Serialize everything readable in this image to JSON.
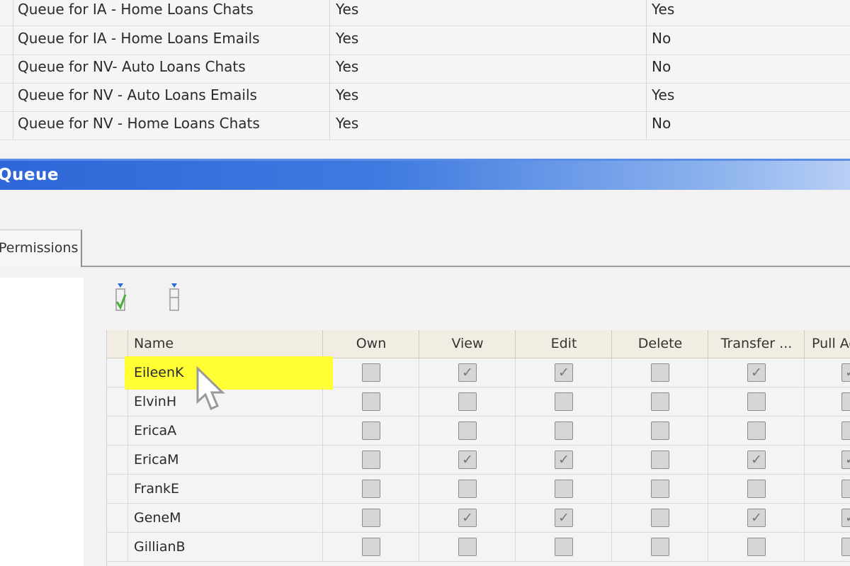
{
  "queue_rows": [
    {
      "name": "Queue for IA - Home Loans Chats",
      "col2": "Yes",
      "col3": "Yes"
    },
    {
      "name": "Queue for IA - Home Loans Emails",
      "col2": "Yes",
      "col3": "No"
    },
    {
      "name": "Queue for NV- Auto Loans Chats",
      "col2": "Yes",
      "col3": "No"
    },
    {
      "name": "Queue for NV - Auto Loans Emails",
      "col2": "Yes",
      "col3": "Yes"
    },
    {
      "name": "Queue for NV - Home Loans Chats",
      "col2": "Yes",
      "col3": "No"
    }
  ],
  "section_title": "Queue",
  "tab_label": "Permissions",
  "toolbar": {
    "icons": [
      "check-all-icon",
      "uncheck-all-icon"
    ]
  },
  "grid": {
    "columns": [
      "Name",
      "Own",
      "View",
      "Edit",
      "Delete",
      "Transfer ...",
      "Pull Ac"
    ],
    "rows": [
      {
        "name": "EileenK",
        "perms": [
          false,
          true,
          true,
          false,
          true,
          true
        ],
        "selected": true
      },
      {
        "name": "ElvinH",
        "perms": [
          false,
          false,
          false,
          false,
          false,
          false
        ],
        "selected": false
      },
      {
        "name": "EricaA",
        "perms": [
          false,
          false,
          false,
          false,
          false,
          false
        ],
        "selected": false
      },
      {
        "name": "EricaM",
        "perms": [
          false,
          true,
          true,
          false,
          true,
          true
        ],
        "selected": false
      },
      {
        "name": "FrankE",
        "perms": [
          false,
          false,
          false,
          false,
          false,
          false
        ],
        "selected": false
      },
      {
        "name": "GeneM",
        "perms": [
          false,
          true,
          true,
          false,
          true,
          true
        ],
        "selected": false
      },
      {
        "name": "GillianB",
        "perms": [
          false,
          false,
          false,
          false,
          false,
          false
        ],
        "selected": false
      }
    ]
  },
  "colors": {
    "title_bar": "#2f66d8",
    "selection_highlight": "#ffff33"
  }
}
